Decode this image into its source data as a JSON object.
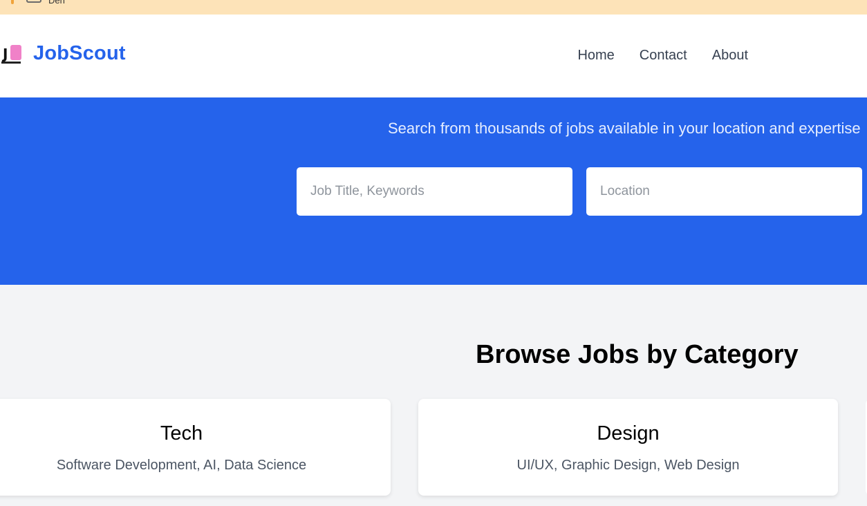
{
  "top_strip": {
    "label": "Den"
  },
  "brand": {
    "name": "JobScout",
    "logo_icon": "js-logo-icon"
  },
  "nav": {
    "links": [
      "Home",
      "Contact",
      "About"
    ]
  },
  "hero": {
    "subtitle": "Search from thousands of jobs available in your location and expertise",
    "keywords_placeholder": "Job Title, Keywords",
    "location_placeholder": "Location",
    "background": "#2563eb"
  },
  "categories": {
    "title": "Browse Jobs by Category",
    "items": [
      {
        "name": "Tech",
        "description": "Software Development, AI, Data Science"
      },
      {
        "name": "Design",
        "description": "UI/UX, Graphic Design, Web Design"
      }
    ]
  },
  "colors": {
    "accent": "#2563eb",
    "page_bg": "#f3f4f6",
    "banner": "#fde3b8"
  }
}
